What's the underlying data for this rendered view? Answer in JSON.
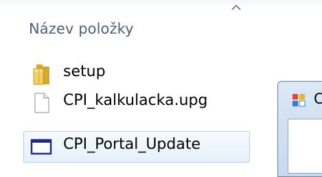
{
  "explorer": {
    "column_header": "Název položky",
    "files": [
      {
        "name": "setup",
        "icon": "folder-icon",
        "selected": false
      },
      {
        "name": "CPI_kalkulacka.upg",
        "icon": "document-icon",
        "selected": false
      },
      {
        "name": "CPI_Portal_Update",
        "icon": "application-window-icon",
        "selected": true
      }
    ]
  },
  "dialog": {
    "title": "C",
    "icon": "application-icon"
  },
  "colors": {
    "header_text": "#4c607a",
    "selection_fill": "#e6f0fa",
    "selection_border": "#b5cde8",
    "folder_yellow": "#e9c04a",
    "window_icon_blue": "#1d2a8c"
  }
}
